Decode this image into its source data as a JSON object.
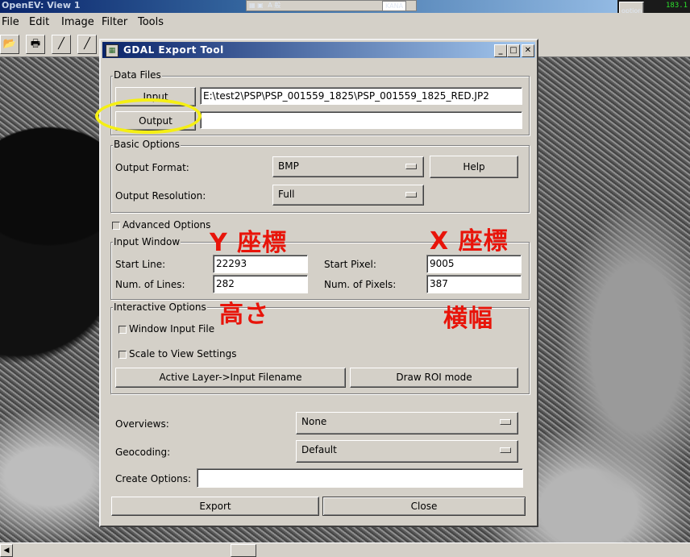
{
  "background_window": {
    "title": "OpenEV: View 1",
    "tray_label": "A 般",
    "tray_kana": "KANA",
    "tray_option": "option",
    "tray_number": "183.1",
    "menu": [
      "File",
      "Edit",
      "Image",
      "Filter",
      "Tools"
    ]
  },
  "dialog": {
    "title": "GDAL Export Tool",
    "data_files": {
      "legend": "Data Files",
      "input_button": "Input",
      "input_value": "E:\\test2\\PSP\\PSP_001559_1825\\PSP_001559_1825_RED.JP2",
      "output_button": "Output",
      "output_value": ""
    },
    "basic_options": {
      "legend": "Basic Options",
      "format_label": "Output Format:",
      "format_value": "BMP",
      "help_button": "Help",
      "resolution_label": "Output Resolution:",
      "resolution_value": "Full"
    },
    "advanced_options": "Advanced Options",
    "input_window": {
      "legend": "Input Window",
      "start_line_label": "Start Line:",
      "start_line_value": "22293",
      "num_lines_label": "Num. of Lines:",
      "num_lines_value": "282",
      "start_pixel_label": "Start Pixel:",
      "start_pixel_value": "9005",
      "num_pixels_label": "Num. of Pixels:",
      "num_pixels_value": "387"
    },
    "interactive_options": {
      "legend": "Interactive Options",
      "window_input_file": "Window Input File",
      "scale_to_view": "Scale to View Settings",
      "active_layer_button": "Active Layer->Input Filename",
      "draw_roi_button": "Draw ROI mode"
    },
    "overviews_label": "Overviews:",
    "overviews_value": "None",
    "geocoding_label": "Geocoding:",
    "geocoding_value": "Default",
    "create_options_label": "Create Options:",
    "create_options_value": "",
    "export_button": "Export",
    "close_button": "Close"
  },
  "annotations": {
    "y_coord": "Y 座標",
    "x_coord": "X 座標",
    "height": "高さ",
    "width": "横幅",
    "color": "#e8140a",
    "highlight_color": "#f5ef14"
  }
}
